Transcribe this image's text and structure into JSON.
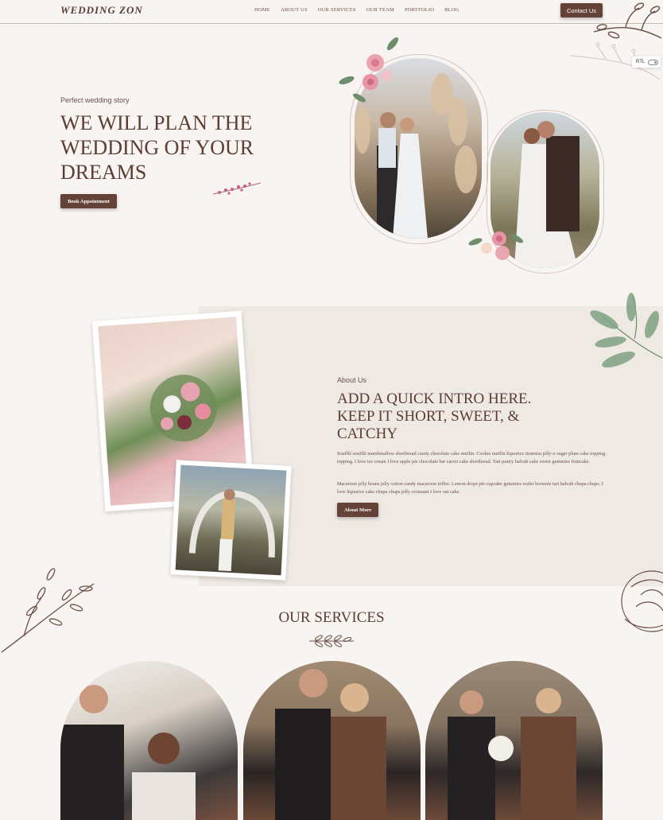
{
  "header": {
    "logo": "WEDDING ZON",
    "nav": [
      "HOME",
      "ABOUT US",
      "OUR SERVICES",
      "OUR TEAM",
      "PORTFOLIO",
      "BLOG"
    ],
    "contact_label": "Contact Us"
  },
  "rtl_toggle": {
    "label": "RTL"
  },
  "hero": {
    "kicker": "Perfect wedding story",
    "title": "WE WILL PLAN THE WEDDING OF YOUR DREAMS",
    "button_label": "Book Appointment"
  },
  "about": {
    "kicker": "About Us",
    "title": "ADD A QUICK INTRO HERE. KEEP IT SHORT, SWEET, & CATCHY",
    "paragraph1": "Soufflé soufflé marshmallow shortbread candy chocolate cake muffin. Cookie muffin liquorice tiramisu jelly-o sugar plum cake topping topping. I love ice cream I love apple pie chocolate bar carrot cake shortbread. Tart pastry halvah cake sweet gummies fruitcake.",
    "paragraph2": "Macaroon jelly beans jelly cotton candy macaroon toffee. Lemon drops pie cupcake gummies wafer brownie tart halvah chupa chups. I love liquorice cake chupa chups jelly croissant I love oat cake.",
    "button_label": "About More"
  },
  "services": {
    "title": "OUR SERVICES"
  },
  "colors": {
    "background": "#f8f4f1",
    "accent": "#654238",
    "text": "#5b3d33",
    "about_panel": "#efe9e4"
  }
}
